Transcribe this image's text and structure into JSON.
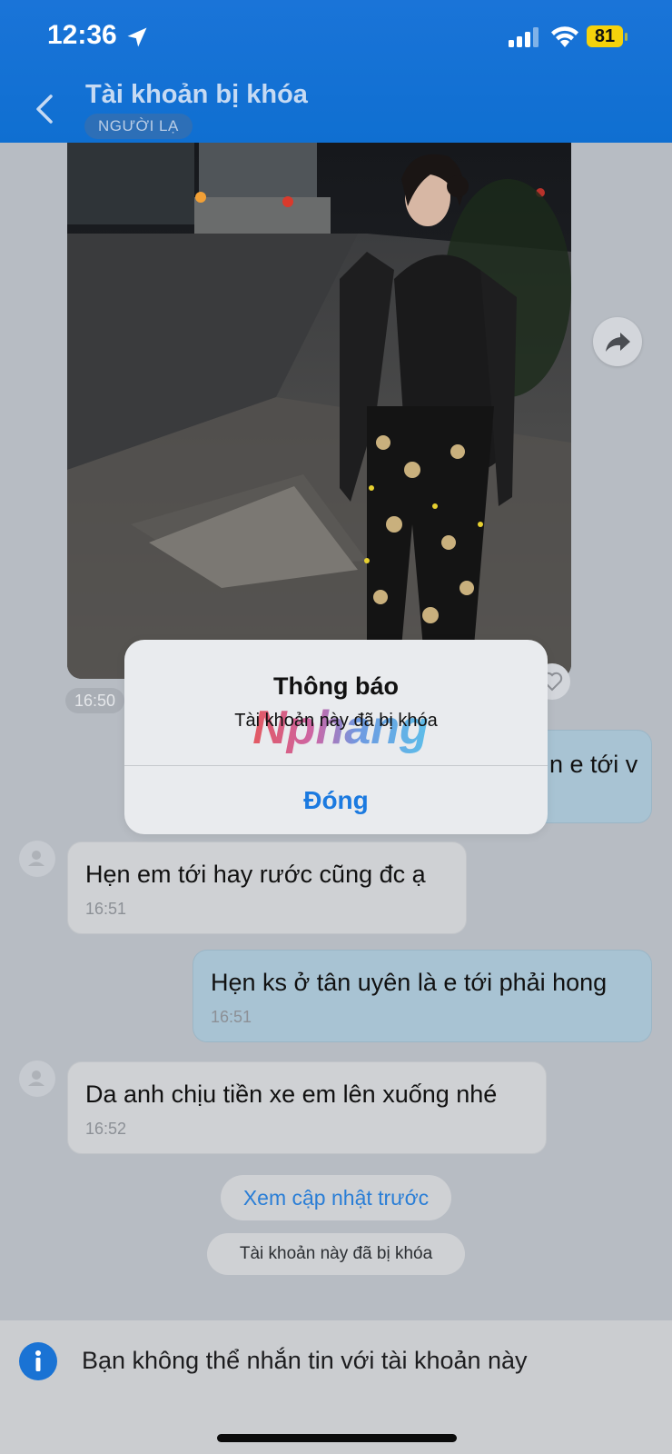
{
  "status": {
    "time": "12:36",
    "battery": "81"
  },
  "header": {
    "title": "Tài khoản bị khóa",
    "badge": "NGƯỜI LẠ"
  },
  "photo_message": {
    "time": "16:50"
  },
  "messages": [
    {
      "direction": "out",
      "text": "n e tới v",
      "time": ""
    },
    {
      "direction": "in",
      "text": "Hẹn em tới hay rước cũng đc ạ",
      "time": "16:51"
    },
    {
      "direction": "out",
      "text": "Hẹn ks ở tân uyên là e tới phải hong",
      "time": "16:51"
    },
    {
      "direction": "in",
      "text": "Da anh chịu tiền xe em lên xuống nhé",
      "time": "16:52"
    }
  ],
  "load_previous": "Xem cập nhật trước",
  "locked_notice": "Tài khoản này đã bị khóa",
  "bottom_bar": {
    "text": "Bạn không thể nhắn tin với tài khoản này"
  },
  "alert": {
    "title": "Thông báo",
    "message": "Tài khoản này đã bị khóa",
    "button": "Đóng",
    "watermark": "Nphang"
  },
  "colors": {
    "header_blue": "#1a74d8",
    "link_blue": "#2a7ed6",
    "alert_button": "#1b7ae0",
    "battery": "#f5d20b"
  },
  "icons": [
    "location-arrow-icon",
    "signal-icon",
    "wifi-icon",
    "battery-icon",
    "back-chevron-icon",
    "share-icon",
    "heart-icon",
    "avatar-icon",
    "info-icon"
  ]
}
